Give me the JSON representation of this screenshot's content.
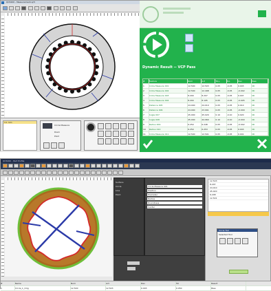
{
  "top": {
    "window_title": "QC5200 - Measurement.qc5",
    "menu_items": [
      "File",
      "Edit",
      "View",
      "Tools",
      "Window",
      "Help"
    ],
    "status_text": "3.1 mm",
    "center_icon": "play-icon",
    "banner_text": "Dynamic Result -- VCP Pass",
    "mini_panel": {
      "title": "Circle Measure",
      "label1": "Diam",
      "label2": "Point"
    },
    "table_header": [
      "#",
      "Feature",
      "Nom",
      "Act",
      "Tol+",
      "Tol-",
      "Dev",
      "Pass"
    ],
    "table_rows": [
      [
        "1",
        "Circle Measure 001",
        "12.500",
        "12.503",
        "0.05",
        "-0.05",
        "0.003",
        "OK"
      ],
      [
        "2",
        "Circle Measure 002",
        "12.500",
        "12.498",
        "0.05",
        "-0.05",
        "-0.002",
        "OK"
      ],
      [
        "3",
        "Circle Measure 003",
        "8.200",
        "8.207",
        "0.05",
        "-0.05",
        "0.007",
        "OK"
      ],
      [
        "4",
        "Circle Measure 004",
        "8.200",
        "8.195",
        "0.05",
        "-0.05",
        "-0.005",
        "OK"
      ],
      [
        "5",
        "Distance 005",
        "24.000",
        "24.010",
        "0.05",
        "-0.05",
        "0.010",
        "OK"
      ],
      [
        "6",
        "Distance 006",
        "24.000",
        "23.991",
        "0.05",
        "-0.05",
        "-0.009",
        "OK"
      ],
      [
        "7",
        "Angle 007",
        "45.000",
        "45.020",
        "0.10",
        "-0.10",
        "0.020",
        "OK"
      ],
      [
        "8",
        "Angle 008",
        "45.000",
        "44.960",
        "0.10",
        "-0.10",
        "-0.040",
        "OK"
      ],
      [
        "9",
        "Radius 009",
        "6.250",
        "6.248",
        "0.05",
        "-0.05",
        "-0.002",
        "OK"
      ],
      [
        "10",
        "Radius 010",
        "6.250",
        "6.253",
        "0.05",
        "-0.05",
        "0.003",
        "OK"
      ],
      [
        "11",
        "Circle Measure 011",
        "12.500",
        "12.501",
        "0.05",
        "-0.05",
        "0.001",
        "OK"
      ],
      [
        "12",
        "Circle Measure 012",
        "12.500",
        "12.506",
        "0.05",
        "-0.05",
        "0.006",
        "OK"
      ]
    ],
    "check_icon": "check-icon",
    "close_icon": "close-icon"
  },
  "bottom": {
    "window_title": "QC5200 - Part Profile",
    "list_items": [
      "Surface",
      "Circle",
      "Line",
      "Point"
    ],
    "right_values": [
      "12.503",
      "8.207",
      "24.010",
      "45.020",
      "6.248",
      "12.501"
    ],
    "props": [
      "Circle Measure 001",
      "Position",
      "Diameter",
      "Radius",
      "Roundness",
      "Center"
    ],
    "dialog_title": "Circle Tool",
    "dialog_subtitle": "Selected Tool",
    "footer_cols": [
      "#",
      "Name",
      "Nom",
      "Act",
      "Dev",
      "Tol",
      "Result"
    ],
    "footer_row": [
      "1",
      "Circle_1_Orig",
      "12.500",
      "12.503",
      "0.003",
      "0.050",
      "Pass"
    ]
  },
  "colors": {
    "green": "#22b24c",
    "green_light": "#e8f6e8",
    "panel_gray": "#dcdcdc",
    "red": "#d42a2a",
    "blue_line": "#2b3aa8",
    "orange_part": "#c06a16"
  }
}
